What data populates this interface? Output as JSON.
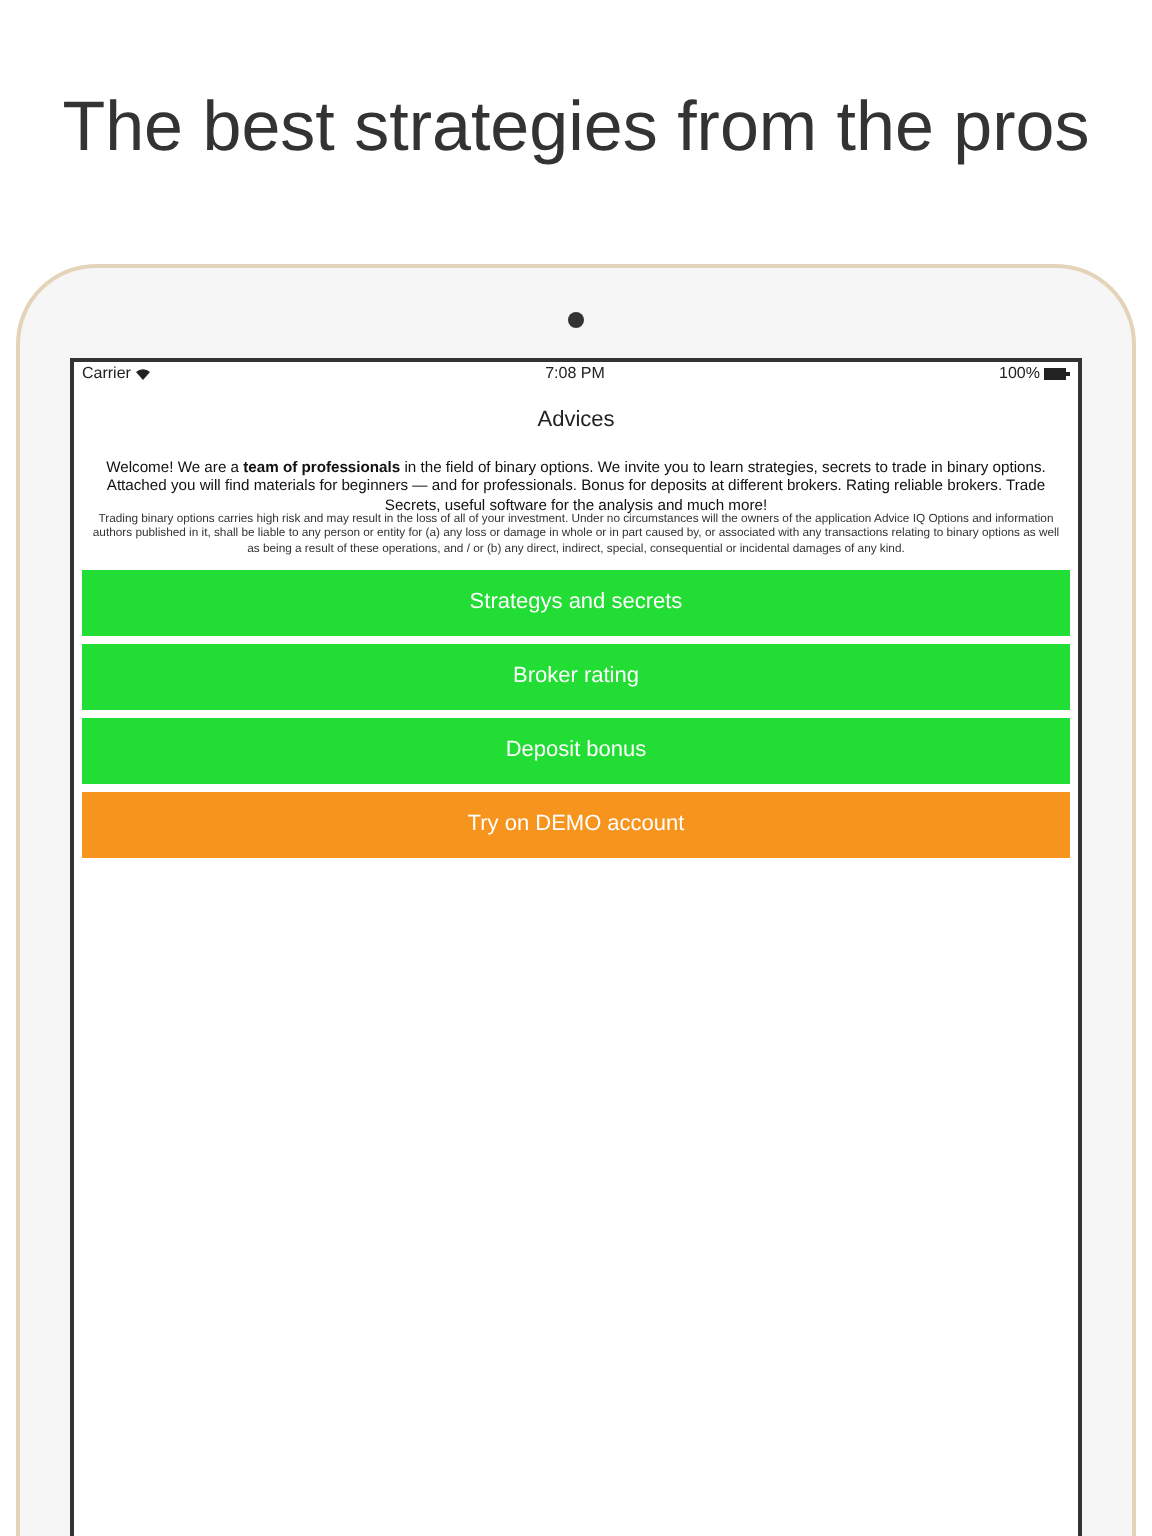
{
  "headline": "The best strategies from the pros",
  "status_bar": {
    "carrier": "Carrier",
    "time": "7:08 PM",
    "battery": "100%"
  },
  "nav": {
    "title": "Advices"
  },
  "intro": "Welcome! We are a **team of professionals** in the field of binary options. We invite you to learn strategies, secrets to trade in binary options.\nAttached you will find materials for beginners — and for professionals. Bonus for deposits at different brokers. Rating reliable brokers. Trade Secrets, useful software for the analysis and much more!",
  "disclaimer": "Trading binary options carries high risk and may result in the loss of all of your investment. Under no circumstances will the owners of the application Advice IQ Options and information authors published in it, shall be liable to any person or entity for (a) any loss or damage in whole or in part caused by, or associated with any transactions relating to binary options as well as being a result of these operations, and / or (b) any direct, indirect, special, consequential or incidental damages of any kind.",
  "buttons": [
    {
      "label": "Strategys and secrets",
      "kind": "primary"
    },
    {
      "label": "Broker rating",
      "kind": "primary"
    },
    {
      "label": "Deposit bonus",
      "kind": "primary"
    },
    {
      "label": "Try on DEMO account",
      "kind": "accent"
    }
  ]
}
